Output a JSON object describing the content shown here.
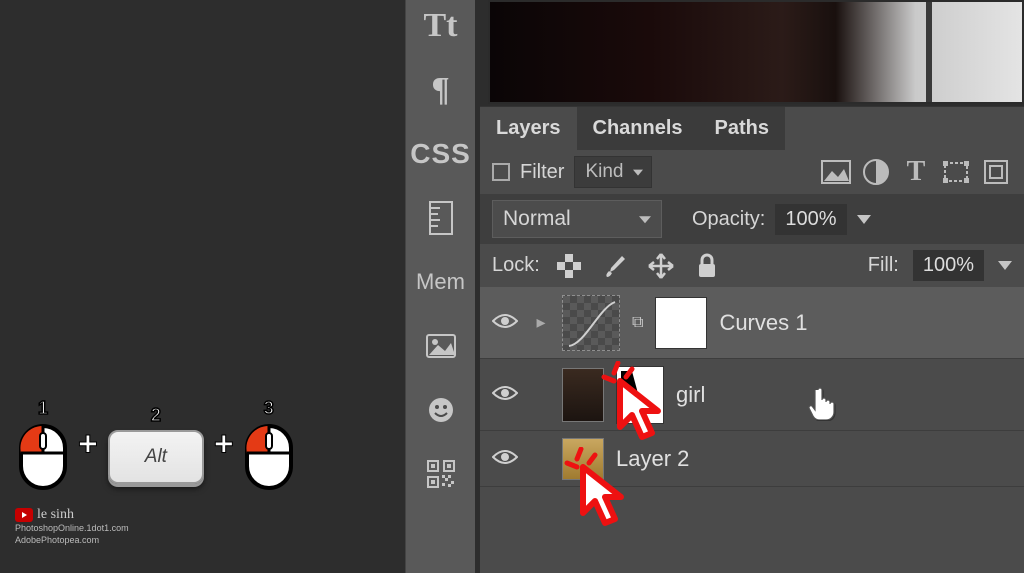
{
  "tutorial": {
    "step1": "1",
    "step2": "2",
    "step3": "3",
    "key_label": "Alt",
    "plus": "+"
  },
  "branding": {
    "channel_name": "le sinh",
    "line1": "PhotoshopOnline.1dot1.com",
    "line2": "AdobePhotopea.com"
  },
  "tool_strip": {
    "tt": "Tt",
    "pilcrow": "¶",
    "css": "CSS",
    "mem": "Mem"
  },
  "panel": {
    "tabs": {
      "layers": "Layers",
      "channels": "Channels",
      "paths": "Paths"
    },
    "filter_label": "Filter",
    "kind_label": "Kind",
    "blend_mode": "Normal",
    "opacity_label": "Opacity:",
    "opacity_value": "100%",
    "lock_label": "Lock:",
    "fill_label": "Fill:",
    "fill_value": "100%",
    "layers": {
      "curves": "Curves 1",
      "girl": "girl",
      "layer2": "Layer 2"
    }
  }
}
